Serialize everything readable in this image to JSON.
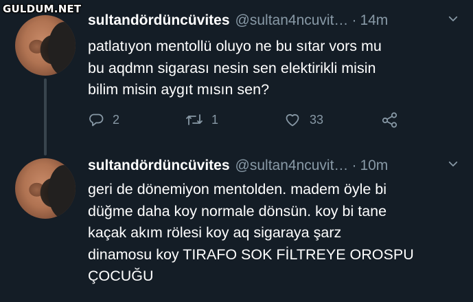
{
  "watermark": "GULDUM.NET",
  "tweets": [
    {
      "name": "sultandördüncüvites",
      "handle": "@sultan4ncuvit…",
      "separator": "·",
      "time": "14m",
      "text_lines": [
        "patlatıyon mentollü oluyo ne bu sıtar vors mu",
        "bu aqdmn sigarası nesin sen elektirikli misin",
        "bilim misin aygıt mısın sen?"
      ],
      "reply_count": "2",
      "retweet_count": "1",
      "like_count": "33"
    },
    {
      "name": "sultandördüncüvites",
      "handle": "@sultan4ncuvit…",
      "separator": "·",
      "time": "10m",
      "text_lines": [
        "geri de dönemiyon mentolden. madem öyle bi",
        "düğme daha koy normale dönsün. koy bi tane",
        "kaçak akım rölesi koy aq sigaraya şarz",
        "dinamosu koy TIRAFO SOK FİLTREYE OROSPU",
        "ÇOCUĞU"
      ]
    }
  ],
  "icons": {
    "reply": "reply-icon",
    "retweet": "retweet-icon",
    "like": "heart-icon",
    "share": "share-icon",
    "more": "chevron-down-icon"
  },
  "colors": {
    "background": "#141d26",
    "text": "#ffffff",
    "secondary": "#8899a6",
    "thread_line": "#38444d"
  }
}
